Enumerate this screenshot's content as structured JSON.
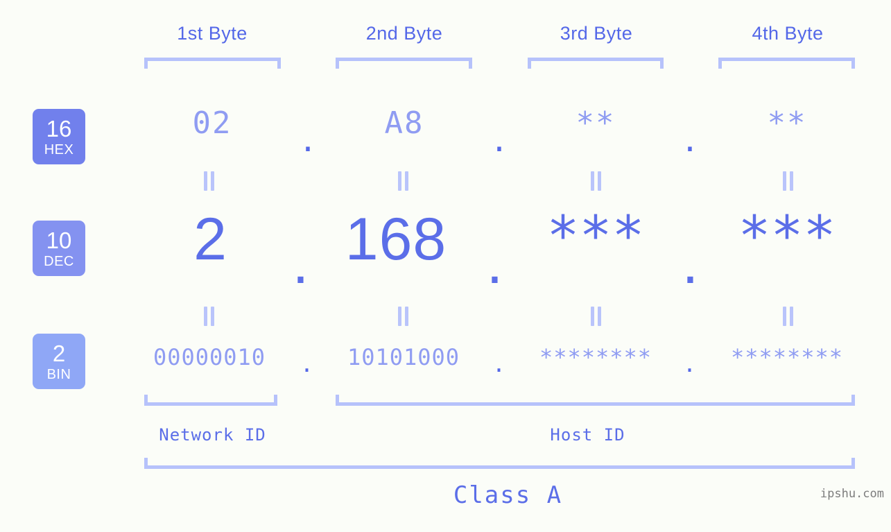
{
  "background_color": "#fbfdf8",
  "accent_colors": {
    "strong": "#5468e8",
    "medium": "#8f9cf2",
    "light": "#b6c2fb",
    "badge_hex": "#7180ec",
    "badge_dec": "#8492f0",
    "badge_bin": "#8fa7f6",
    "watermark": "#7d7d7d"
  },
  "byte_headers": [
    {
      "label": "1st Byte"
    },
    {
      "label": "2nd Byte"
    },
    {
      "label": "3rd Byte"
    },
    {
      "label": "4th Byte"
    }
  ],
  "radix_badges": [
    {
      "number": "16",
      "name": "HEX"
    },
    {
      "number": "10",
      "name": "DEC"
    },
    {
      "number": "2",
      "name": "BIN"
    }
  ],
  "rows": {
    "hex": {
      "radix": "16",
      "radix_name": "HEX",
      "bytes": [
        "02",
        "A8",
        "**",
        "**"
      ],
      "separator": "."
    },
    "dec": {
      "radix": "10",
      "radix_name": "DEC",
      "bytes": [
        "2",
        "168",
        "***",
        "***"
      ],
      "separator": "."
    },
    "bin": {
      "radix": "2",
      "radix_name": "BIN",
      "bytes": [
        "00000010",
        "10101000",
        "********",
        "********"
      ],
      "separator": "."
    }
  },
  "equals_glyph": "||",
  "captions": {
    "network_id": "Network ID",
    "host_id": "Host ID",
    "address_class": "Class A"
  },
  "watermark": "ipshu.com"
}
